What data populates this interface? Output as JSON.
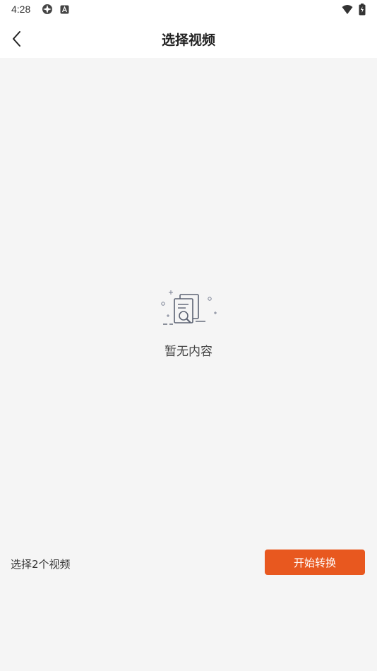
{
  "status_bar": {
    "time": "4:28",
    "icons": [
      "privacy-dot-icon",
      "app-a-icon",
      "wifi-icon",
      "battery-icon"
    ]
  },
  "header": {
    "title": "选择视频",
    "back_icon": "chevron-left-icon"
  },
  "empty_state": {
    "icon": "empty-document-search-icon",
    "message": "暂无内容"
  },
  "footer": {
    "selection_text": "选择2个视频",
    "start_button_label": "开始转换"
  },
  "colors": {
    "accent": "#e8581f",
    "background": "#f5f5f5",
    "surface": "#ffffff"
  }
}
